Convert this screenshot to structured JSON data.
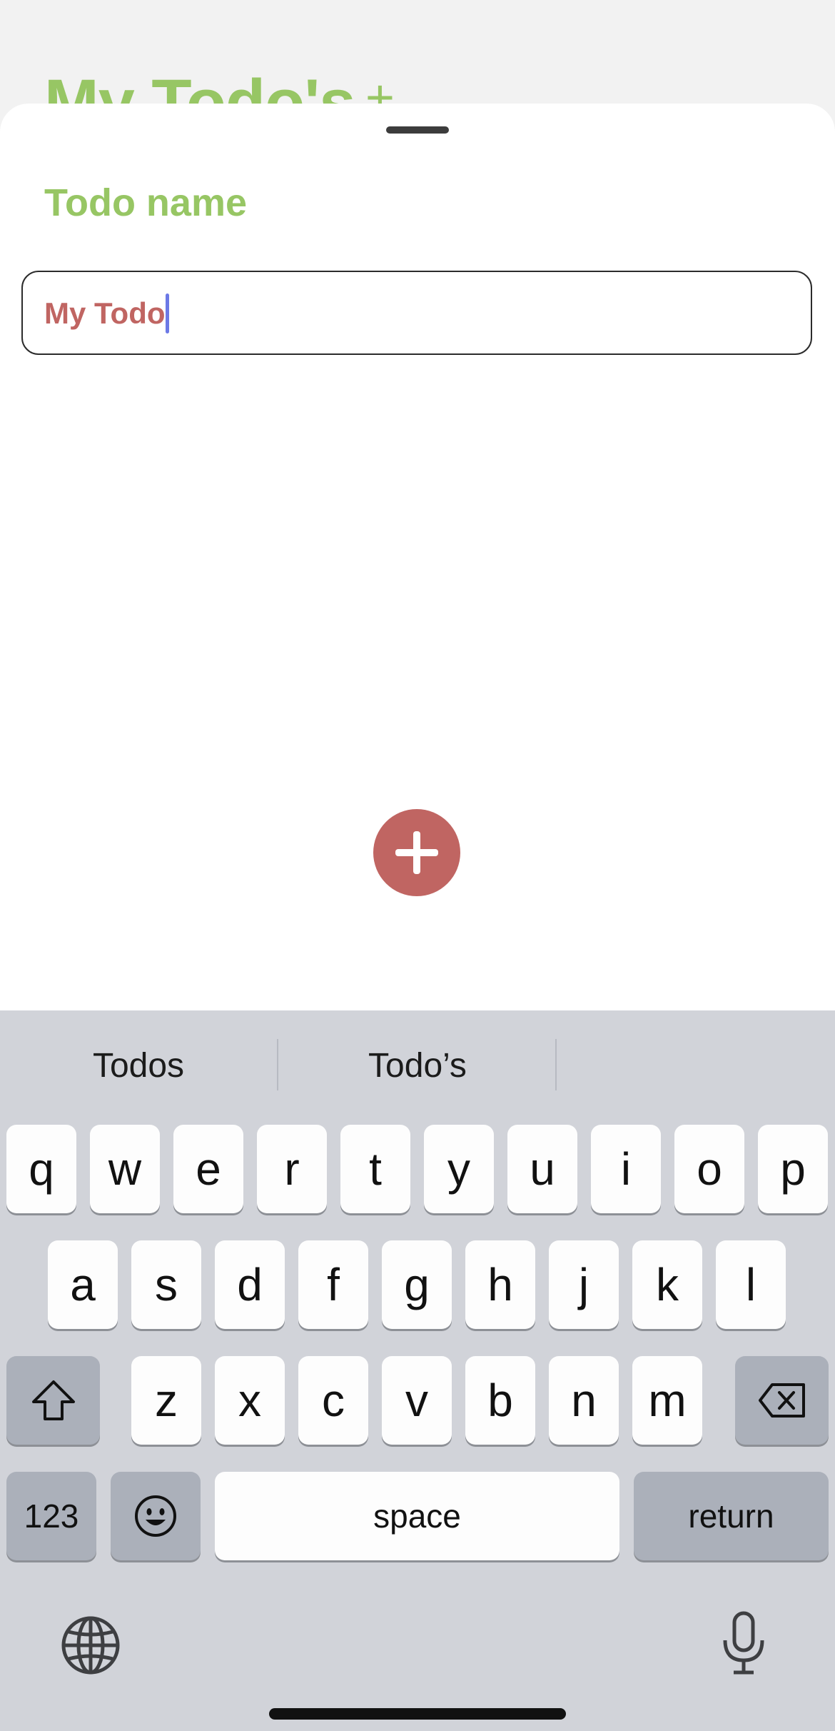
{
  "background": {
    "title": "My Todo's",
    "add_symbol": "+"
  },
  "sheet": {
    "title": "Todo name",
    "input_value": "My Todo",
    "add_button_icon": "plus-icon"
  },
  "keyboard": {
    "suggestions": [
      "Todos",
      "Todo’s",
      ""
    ],
    "row1": [
      "q",
      "w",
      "e",
      "r",
      "t",
      "y",
      "u",
      "i",
      "o",
      "p"
    ],
    "row2": [
      "a",
      "s",
      "d",
      "f",
      "g",
      "h",
      "j",
      "k",
      "l"
    ],
    "row3": [
      "z",
      "x",
      "c",
      "v",
      "b",
      "n",
      "m"
    ],
    "numbers_label": "123",
    "space_label": "space",
    "return_label": "return",
    "icons": [
      "shift-icon",
      "backspace-icon",
      "emoji-icon",
      "globe-icon",
      "mic-icon"
    ]
  },
  "colors": {
    "accent_green": "#97c664",
    "accent_red": "#c06562",
    "caret": "#6c79e6",
    "keyboard_bg": "#d1d3d9"
  }
}
